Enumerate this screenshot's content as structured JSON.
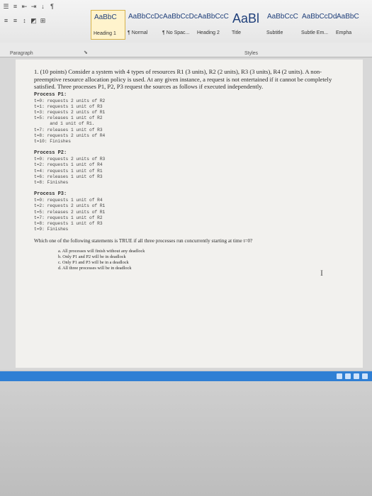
{
  "ribbon": {
    "paragraph_group_label": "Paragraph",
    "styles_group_label": "Styles",
    "styles": [
      {
        "sample": "AaBbC",
        "name": "Heading 1",
        "active": true
      },
      {
        "sample": "AaBbCcDc",
        "name": "¶ Normal",
        "active": false
      },
      {
        "sample": "AaBbCcDc",
        "name": "¶ No Spac...",
        "active": false
      },
      {
        "sample": "AaBbCcC",
        "name": "Heading 2",
        "active": false
      },
      {
        "sample": "AaBl",
        "name": "Title",
        "active": false
      },
      {
        "sample": "AaBbCcC",
        "name": "Subtitle",
        "active": false
      },
      {
        "sample": "AaBbCcDd",
        "name": "Subtle Em...",
        "active": false
      },
      {
        "sample": "AaBbC",
        "name": "Empha",
        "active": false
      }
    ]
  },
  "document": {
    "question_intro": "1. (10 points) Consider a system with 4 types of resources R1 (3 units), R2 (2 units), R3 (3 units), R4 (2 units). A non-preemptive resource allocation policy is used. At any given instance, a request is not entertained if it cannot be completely satisfied. Three processes P1, P2, P3 request the sources as follows if executed independently.",
    "processes": [
      {
        "title": "Process P1:",
        "events": [
          "t=0: requests 2 units of R2",
          "t=1: requests 1 unit of R3",
          "t=3: requests 2 units of R1",
          "t=5: releases 1 unit of R2",
          "      and 1 unit of R1.",
          "t=7: releases 1 unit of R3",
          "t=8: requests 2 units of R4",
          "t=10: Finishes"
        ]
      },
      {
        "title": "Process P2:",
        "events": [
          "t=0: requests 2 units of R3",
          "t=2: requests 1 unit of R4",
          "t=4: requests 1 unit of R1",
          "t=6: releases 1 unit of R3",
          "t=8: Finishes"
        ]
      },
      {
        "title": "Process P3:",
        "events": [
          "t=0: requests 1 unit of R4",
          "t=2: requests 2 units of R1",
          "t=5: releases 2 units of R1",
          "t=7: requests 1 unit of R2",
          "t=8: requests 1 unit of R3",
          "t=9: Finishes"
        ]
      }
    ],
    "prompt": "Which one of the following statements is TRUE if all three processes run concurrently starting at time t=0?",
    "options": [
      "a.  All processes will finish without any deadlock",
      "b.  Only P1 and P2 will be in deadlock",
      "c.  Only P1 and P3 will be in a deadlock",
      "d.  All three processes will be in deadlock"
    ]
  }
}
